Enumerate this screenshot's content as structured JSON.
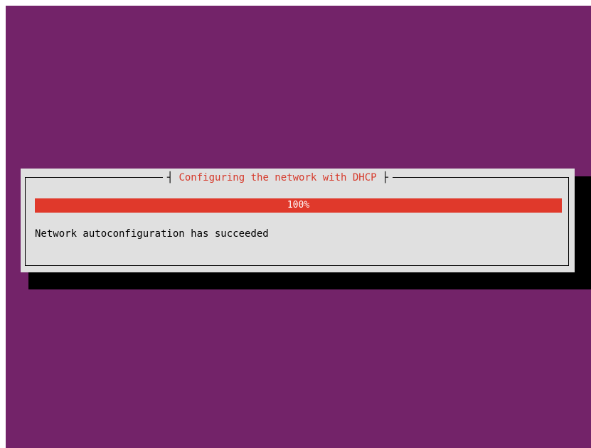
{
  "dialog": {
    "title": "Configuring the network with DHCP",
    "bracket_left": "┤",
    "bracket_right": "├"
  },
  "progress": {
    "value": 1.0,
    "label": "100%"
  },
  "status": {
    "message": "Network autoconfiguration has succeeded"
  },
  "colors": {
    "background": "#732369",
    "dialog": "#e0e0e0",
    "accent": "#e0392b",
    "title": "#d63a2b",
    "shadow": "#000000"
  }
}
